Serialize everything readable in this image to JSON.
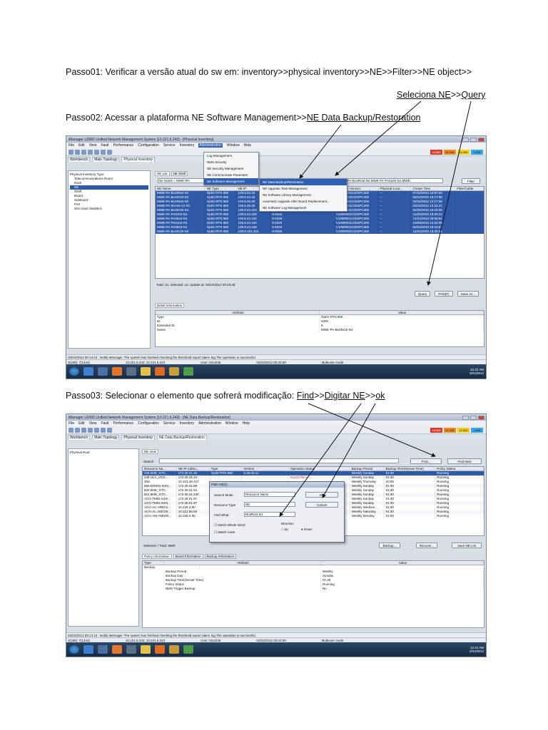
{
  "steps": {
    "step1": "Passo01: Verificar a versão atual do sw em: inventory>>physical inventory>>NE>>Filter>>NE object>>",
    "step1_note_a": "Seleciona NE",
    "step1_note_sep": ">>",
    "step1_note_b": "Query",
    "step2_prefix": "Passo02: Acessar a plataforma NE Software Management>>",
    "step2_link": "NE Data Backup/Restoration",
    "step3_prefix": "Passo03: Selecionar o elemento que sofrerá modificação: ",
    "step3_find": "Find",
    "step3_sep1": ">>",
    "step3_type": "Digitar NE",
    "step3_sep2": ">>",
    "step3_ok": "ok"
  },
  "shot1": {
    "title": "iManager U2000 Unified Network Management System [10.221.6.243] - [Physical Inventory]",
    "menu": [
      "File",
      "Edit",
      "View",
      "Fault",
      "Performance",
      "Configuration",
      "Service",
      "Inventory",
      "Administration",
      "Window",
      "Help"
    ],
    "alarms": [
      "16,566",
      "21,346",
      "11,530",
      "1,835"
    ],
    "tabs": [
      "Workbench",
      "Main Topology",
      "Physical Inventory"
    ],
    "tree": [
      "Physical Inventory Type",
      "Telecommunications Room",
      "Rack",
      "NE",
      "Shelf",
      "Board",
      "Subboard",
      "Port",
      "Slot Used Statistics"
    ],
    "subtabs": [
      "NE List",
      "NE Shelf"
    ],
    "filter_text": "Ne Name = MWE-PA-",
    "filter_tail": "BLMN16-N1,MWE-PA-BLMN16-N2,MWE-PA-PA0104-N1,MWE-",
    "filter_btn": "Filter",
    "admin_menu": [
      "Log Management",
      "NMS Security",
      "NE Security Management",
      "NE Communicate Parameter",
      "NE Software Management"
    ],
    "sw_menu": [
      "NE Data Backup/Restoration",
      "NE Upgrade Task Management",
      "NE Software Library Management",
      "Automatic Upgrade After Board Replacement...",
      "NE Software Log Management"
    ],
    "columns": [
      "NE Name",
      "NE Type",
      "NE IP",
      "NE ID",
      "Software Version",
      "Physical Loca...",
      "Create Time",
      "Fiber/Cable"
    ],
    "rows": [
      [
        "MWE-PA-BLMN16-N1",
        "OptiX RTN 950",
        "129.9.24.16",
        "9-5305",
        "V100R001C02SPC300",
        "--",
        "07/22/2010 15:57:04",
        ""
      ],
      [
        "MWE-PA-BLMC04-N1",
        "OptiX RTN 950",
        "129.9.24.18",
        "9-5316",
        "V100R001C02SPC300",
        "--",
        "03/10/2010 16:17:08",
        ""
      ],
      [
        "MWE-PA-BLMN16-N2",
        "OptiX RTN 950",
        "129.9.25.30",
        "9-5306",
        "V100R001C02SPC300",
        "--",
        "03/16/2012 12:17:58",
        ""
      ],
      [
        "MWE-PA-MAAN-12-N1",
        "OptiX RTN 950",
        "129.9.25.30",
        "9-5324",
        "V100R001C02SPC300",
        "--",
        "03/15/2012 12:15:21",
        ""
      ],
      [
        "MWE-PA-BLMC26-N1",
        "OptiX RTN 950",
        "129.9.24.203",
        "9-5307",
        "V100R001C02SPC300",
        "--",
        "02/25/2010 15:19:25",
        ""
      ],
      [
        "MWE-PA-PA0104-N1",
        "OptiX RTN 950",
        "129.9.24.159",
        "9-5333",
        "V100R001C02SPC300",
        "--",
        "10/20/2010 19:29:24",
        ""
      ],
      [
        "MWE-PA-PA0515-N2",
        "OptiX RTN 950",
        "129.9.24.162",
        "9-5326",
        "V100R001C02SPC300",
        "--",
        "12/22/2010 09:58:51",
        ""
      ],
      [
        "MWE-PA-PA0104-N1",
        "OptiX RTN 950",
        "129.9.24.162",
        "9-5325",
        "V100R001C02SPC300",
        "--",
        "10/08/2010 12:52:05",
        ""
      ],
      [
        "MWE-PA-PA0515-N1",
        "OptiX RTN 950",
        "129.9.24.189",
        "9-5333",
        "V100R001C02SPC300",
        "--",
        "02/22/2010 19:16:57",
        ""
      ],
      [
        "MWE-PA-BLMC26-N2",
        "OptiX RTN 950",
        "129.9.191.163",
        "9-5095",
        "V100R001C02SPC300",
        "--",
        "12/03/2010 13:45:34",
        ""
      ]
    ],
    "total": "Total: 10, Selected: 10,  Update at: 03/24/2012 00:19:38",
    "buttons": [
      "Query",
      "Print(P)",
      "Save As..."
    ],
    "detail_tab": "Detail Information",
    "detail_cols": [
      "Attribute",
      "Value"
    ],
    "detail_rows": [
      [
        "Type",
        "OptiX RTN 950"
      ],
      [
        "ID",
        "5305"
      ],
      [
        "Extended ID",
        "9"
      ],
      [
        "Name",
        "MWE-PA-BLMN16-N1"
      ]
    ],
    "status_log": "03/24/2012 00:14:13 : Notify Message: The system has finished checking the threshold export alarm log.The operation is successful.",
    "status_bar": [
      "3(199): 7(1444)",
      "10.221.6.243: 10.221.6.243",
      "User: t324236",
      "03/24/2012 00:22:59",
      "Multiuser mode"
    ],
    "clock": [
      "12:22 AM",
      "3/24/2012"
    ]
  },
  "shot2": {
    "title": "iManager U2000 Unified Network Management System [10.221.6.243] - [NE Data Backup/Restoration]",
    "menu": [
      "File",
      "Edit",
      "View",
      "Fault",
      "Performance",
      "Configuration",
      "Service",
      "Inventory",
      "Administration",
      "Window",
      "Help"
    ],
    "alarms": [
      "16,566",
      "21,335",
      "11,533",
      "1,836"
    ],
    "tabs": [
      "Workbench",
      "Main Topology",
      "Physical Inventory",
      "NE Data Backup/Restoration"
    ],
    "tree": [
      "Physical Root"
    ],
    "view_tab": "NE View",
    "search_label": "Search",
    "find_btn": "Find...",
    "find_next_btn": "Find Next",
    "columns": [
      "Resource Na...",
      "NE IP Ad/Su...",
      "Type",
      "Version",
      "Operation Status",
      "Backup Period",
      "Backup Time(Server Time)",
      "Policy Status"
    ],
    "rows": [
      [
        "235 BHE_GTC...",
        "172.30.31.26",
        "OptiX RTN 980",
        "5.36.03.11",
        "",
        "Weekly Sunday",
        "01:30",
        "Running"
      ],
      [
        "249 ULA_VGS...",
        "172.30.31.24",
        "",
        "",
        "Export the c...",
        "Weekly Sunday",
        "01:30",
        "Running"
      ],
      [
        "393",
        "10.223.49.227",
        "",
        "",
        "",
        "Weekly Thursday",
        "20:00",
        "Running"
      ],
      [
        "592-ERS01-N1N...",
        "172.30.31.89",
        "",
        "",
        "",
        "Weekly Sunday",
        "01:30",
        "Running"
      ],
      [
        "820 BHE_GTC...",
        "172.30.31.54",
        "",
        "",
        "Export the c...",
        "Weekly Sunday",
        "01:30",
        "Running"
      ],
      [
        "821 BHE_GTC...",
        "172.30.31.230",
        "",
        "",
        "Export the c...",
        "Weekly Sunday",
        "01:30",
        "Running"
      ],
      [
        "ACG-TM01-N1N...",
        "172.28.01.97",
        "",
        "",
        "Restore th...",
        "Weekly Sunday",
        "01:30",
        "Running"
      ],
      [
        "ACG-TM01-N1N...",
        "172.28.01.97",
        "",
        "",
        "Restore th...",
        "Weekly Sunday",
        "01:30",
        "Running"
      ],
      [
        "ACG-AC-ARE01...",
        "10.225.3.90",
        "",
        "",
        "",
        "Weekly Wednes...",
        "01:30",
        "Running"
      ],
      [
        "ACG-AL-AMC00...",
        "10.212.96.50",
        "",
        "",
        "",
        "Weekly Saturday",
        "01:30",
        "Running"
      ],
      [
        "ACG-AM-AMN00...",
        "10.228.0.90",
        "",
        "",
        "",
        "Weekly Monday",
        "01:00",
        "Running"
      ]
    ],
    "dialog_title": "Filter NE(s)",
    "search_mode_label": "Search Mode",
    "search_mode_value": "Resource Name",
    "resource_type_label": "Resource Type",
    "resource_type_value": "NE",
    "find_what_label": "Find What:",
    "find_what_value": "BLMN16-N1",
    "ok_btn": "OK",
    "cancel_btn": "Cancel",
    "match_whole": "Match Whole Word",
    "match_case": "Match Case",
    "direction_label": "Direction",
    "dir_up": "Up",
    "dir_down": "Down",
    "selected": "Selected: / Total: 5909",
    "action_buttons": [
      "Backup...",
      "Recover...",
      "Save NE List"
    ],
    "bottom_tabs": [
      "Policy Information",
      "Board Information",
      "Backup Information"
    ],
    "detail_cols": [
      "Type",
      "Attribute",
      "Value"
    ],
    "detail_group": "Backup",
    "detail_rows": [
      [
        "Backup Period",
        "Weekly"
      ],
      [
        "Backup Day",
        "Sunday"
      ],
      [
        "Backup Time(Server Time)",
        "01:30"
      ],
      [
        "Policy Status",
        "Running"
      ],
      [
        "NMS Trigger Backup",
        "No"
      ]
    ],
    "status_log": "03/24/2012 00:14:13 : Notify Message: The system has finished checking the threshold export alarm log.The operation is successful.",
    "status_bar": [
      "3(199): 7(1444)",
      "10.221.6.243: 10.221.6.243",
      "User: t324236",
      "03/24/2012 00:24:59",
      "Multiuser mode"
    ],
    "clock": [
      "12:24 AM",
      "3/24/2012"
    ]
  },
  "colors": {
    "selection": "#2f5aa8",
    "alarm_critical": "#d93a2a",
    "alarm_major": "#ef8a1d",
    "alarm_minor": "#f5d11c",
    "alarm_warning": "#38a7e6"
  }
}
